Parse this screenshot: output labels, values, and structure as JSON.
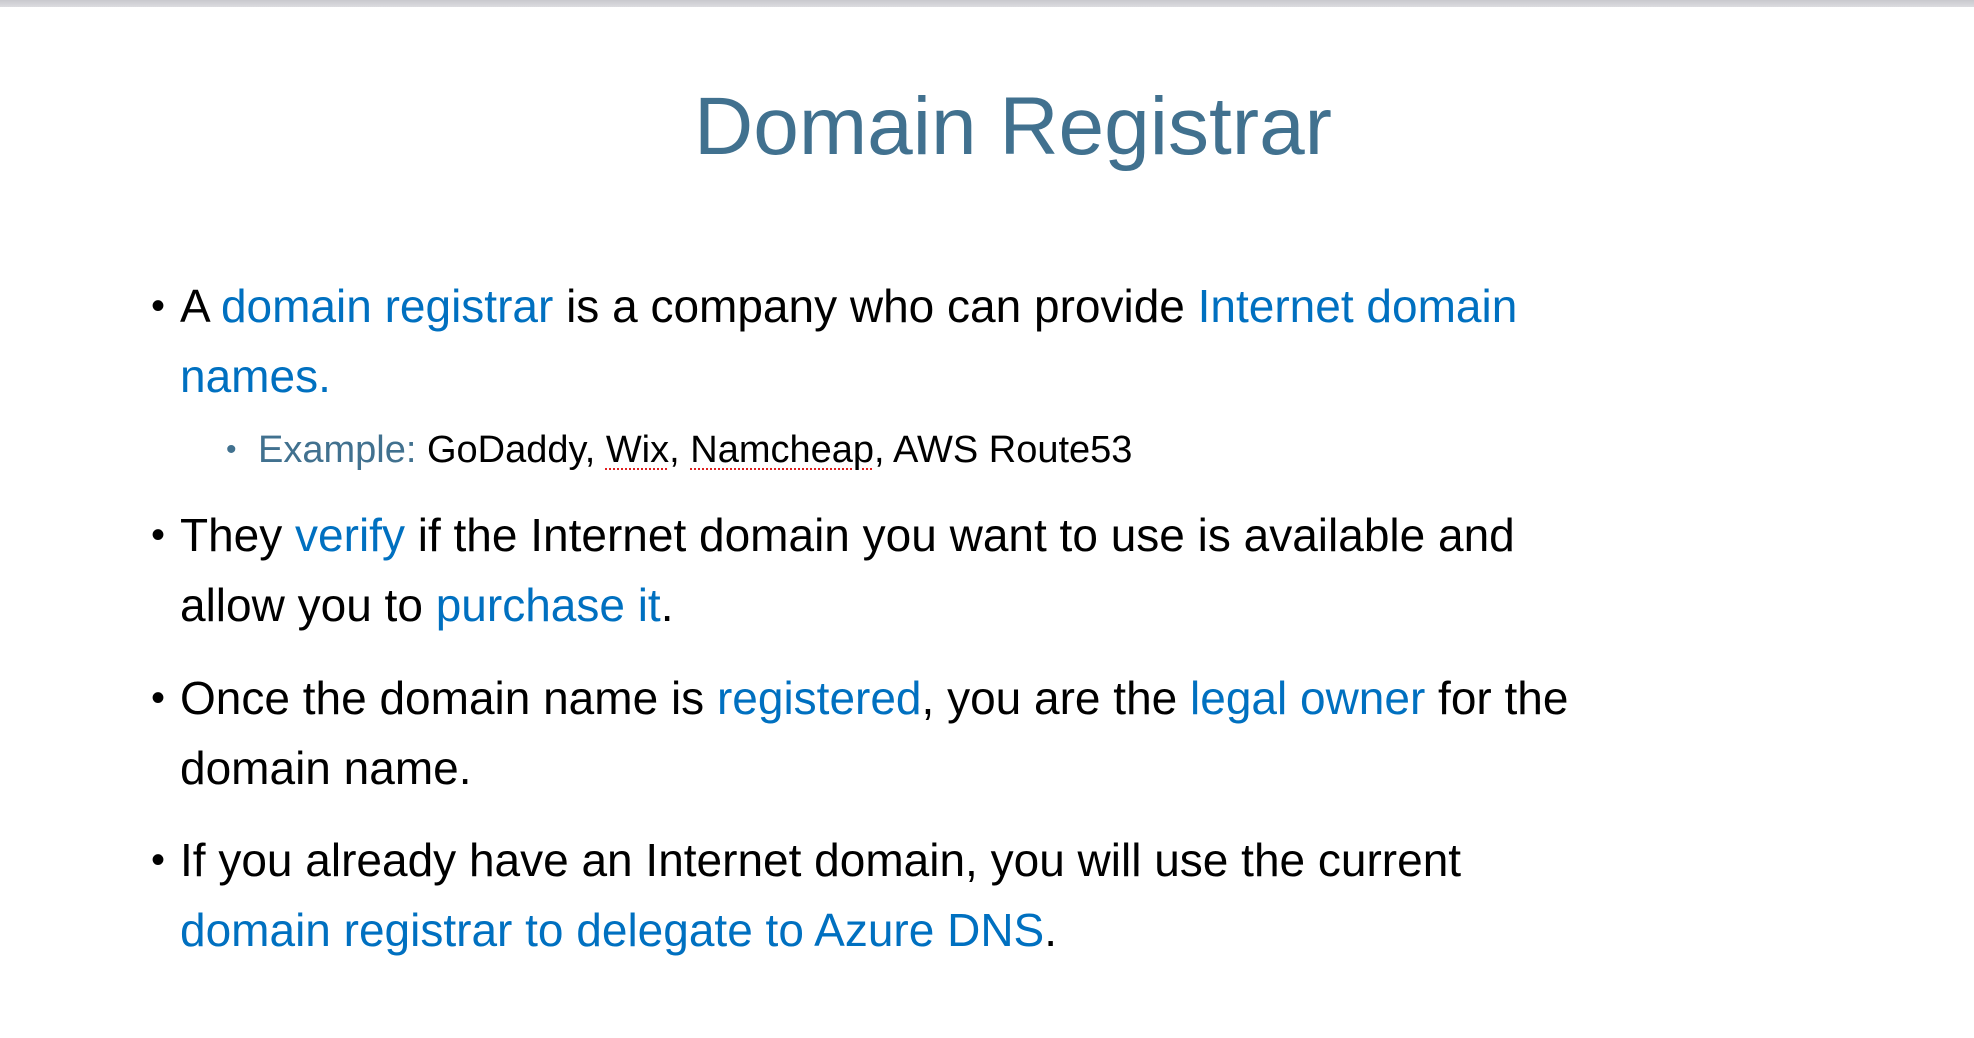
{
  "slide": {
    "title": "Domain Registrar",
    "colors": {
      "title": "#41718f",
      "highlight": "#0070c0",
      "body": "#000000",
      "spellcheck": "#e02020"
    },
    "bullets": [
      {
        "line1": {
          "a": "A ",
          "b": "domain registrar",
          "c": " is a company who can provide ",
          "d": "Internet domain"
        },
        "line2": {
          "a": "names."
        }
      },
      {
        "line1": {
          "a": "They ",
          "b": "verify",
          "c": " if the Internet domain you want to use is available and"
        },
        "line2": {
          "a": "allow you to ",
          "b": "purchase it",
          "c": "."
        }
      },
      {
        "line1": {
          "a": "Once the domain name is ",
          "b": "registered",
          "c": ", you are the ",
          "d": "legal owner",
          "e": " for the"
        },
        "line2": {
          "a": "domain name."
        }
      },
      {
        "line1": {
          "a": "If you already have an Internet domain, you will use the current"
        },
        "line2": {
          "a": "domain registrar to delegate to Azure DNS",
          "b": "."
        }
      }
    ],
    "sub_bullet": {
      "label": "Example:",
      "items": [
        "GoDaddy",
        "Wix",
        "Namcheap",
        "AWS Route53"
      ]
    }
  }
}
